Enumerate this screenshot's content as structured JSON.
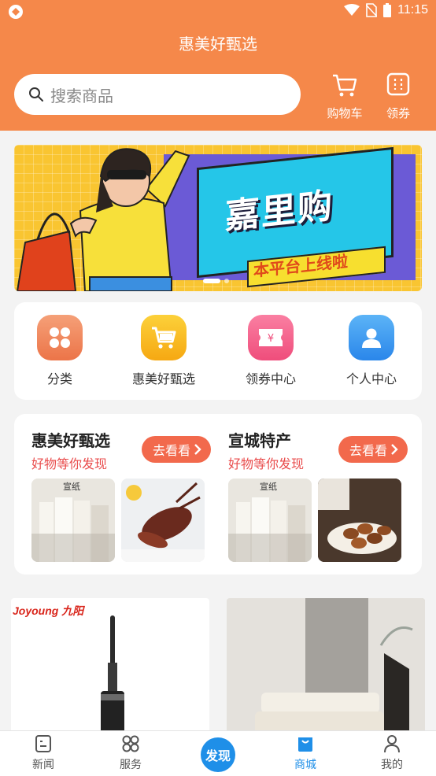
{
  "status_bar": {
    "time": "11:15"
  },
  "header": {
    "title": "惠美好甄选",
    "search_placeholder": "搜索商品",
    "cart_label": "购物车",
    "coupon_label": "领券",
    "background_color": "#f5884a"
  },
  "banner": {
    "headline": "嘉里购",
    "subline": "本平台上线啦"
  },
  "quick_menu": {
    "items": [
      {
        "label": "分类",
        "icon": "grid-icon",
        "color": "#f08a5a"
      },
      {
        "label": "惠美好甄选",
        "icon": "cart-icon",
        "color": "#f9b21a"
      },
      {
        "label": "领券中心",
        "icon": "ticket-icon",
        "color": "#f45a86"
      },
      {
        "label": "个人中心",
        "icon": "person-icon",
        "color": "#2f93f0"
      }
    ]
  },
  "promos": [
    {
      "title": "惠美好甄选",
      "subtitle": "好物等你发现",
      "button": "去看看"
    },
    {
      "title": "宣城特产",
      "subtitle": "好物等你发现",
      "button": "去看看"
    }
  ],
  "products": [
    {
      "brand": "Joyoung 九阳"
    }
  ],
  "tabbar": {
    "items": [
      {
        "label": "新闻",
        "icon": "news-icon"
      },
      {
        "label": "服务",
        "icon": "service-icon"
      },
      {
        "label": "发现",
        "icon": "discover-icon"
      },
      {
        "label": "商城",
        "icon": "mall-bag-icon"
      },
      {
        "label": "我的",
        "icon": "profile-icon"
      }
    ],
    "active": "商城",
    "active_color": "#1f8fe8"
  }
}
